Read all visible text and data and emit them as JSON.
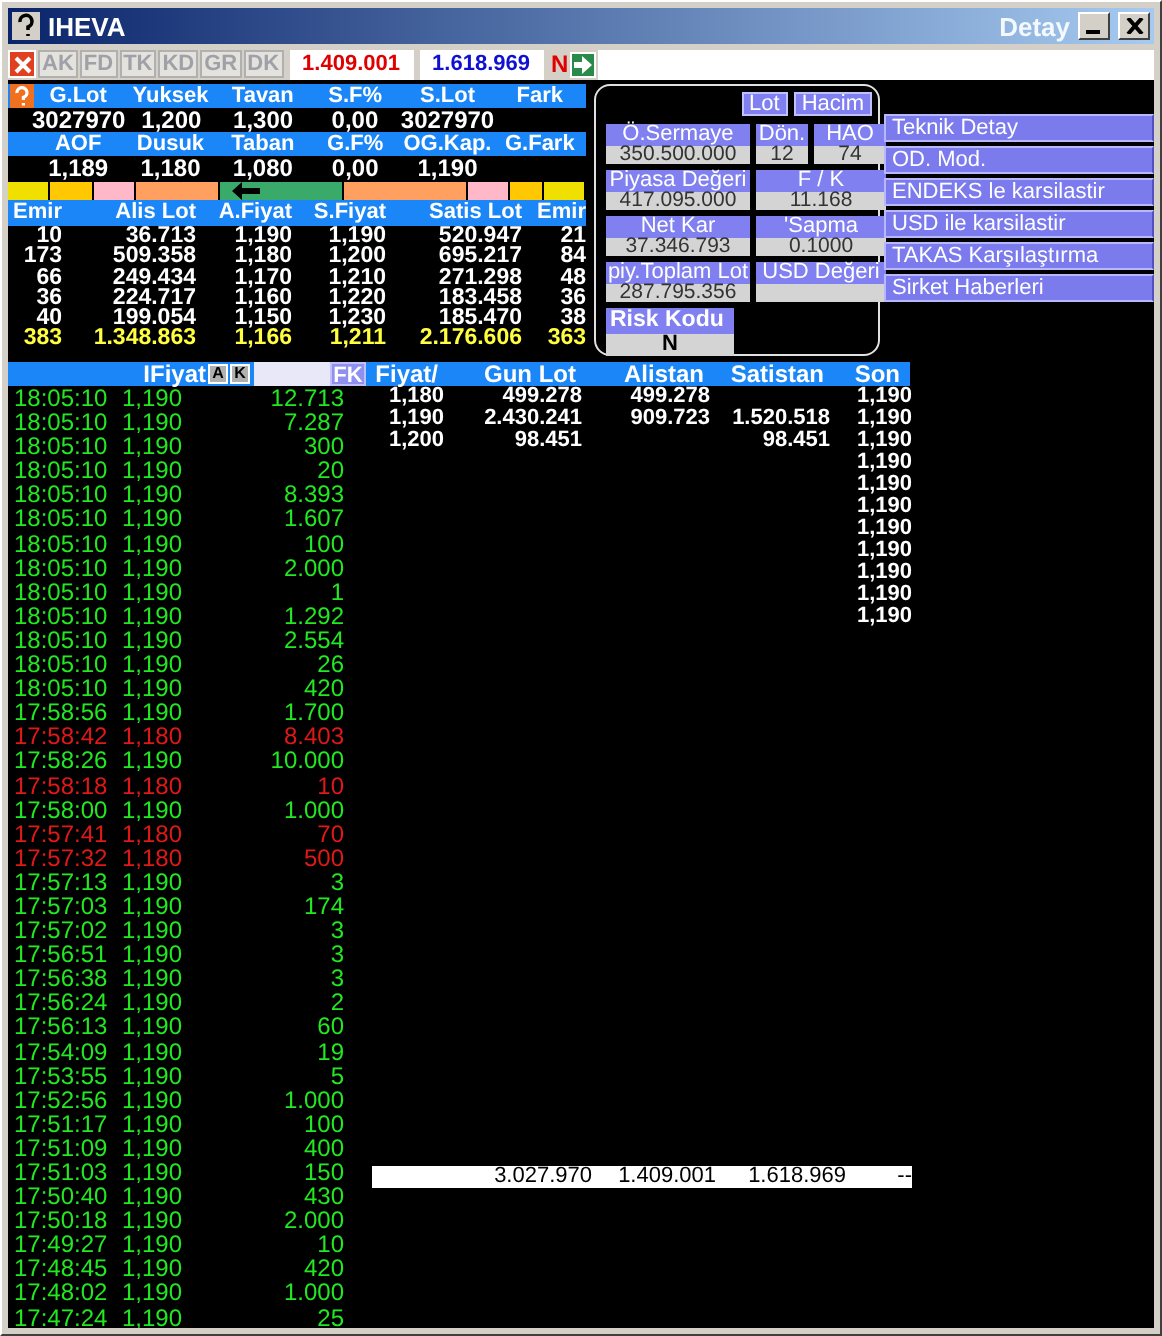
{
  "window": {
    "title": "IHEVA",
    "subtitle": "Detay"
  },
  "toolbar": {
    "tabs": [
      {
        "label": "AK",
        "disabled": true
      },
      {
        "label": "FD",
        "disabled": true
      },
      {
        "label": "TK",
        "disabled": true
      },
      {
        "label": "KD",
        "disabled": true
      },
      {
        "label": "GR",
        "disabled": true
      },
      {
        "label": "DK",
        "disabled": true
      }
    ],
    "value_red": "1.409.001",
    "value_blue": "1.618.969",
    "flag": "N"
  },
  "summary_rows": [
    {
      "kind": "header",
      "cells": [
        "G.Lot",
        "Yuksek",
        "Tavan",
        "S.F%",
        "S.Lot",
        "Fark"
      ]
    },
    {
      "kind": "values",
      "cells": [
        "3027970",
        "1,200",
        "1,300",
        "0,00",
        "3027970"
      ]
    },
    {
      "kind": "header",
      "cells": [
        "AOF",
        "Dusuk",
        "Taban",
        "G.F%",
        "OG.Kap.",
        "G.Fark"
      ]
    },
    {
      "kind": "values",
      "cells": [
        "1,189",
        "1,180",
        "1,080",
        "0,00",
        "1,190"
      ]
    }
  ],
  "depth_bar": [
    {
      "color": "#f0e000",
      "kind": "narrow"
    },
    {
      "color": "#ffc800",
      "kind": "narrow"
    },
    {
      "color": "#ffb8c8",
      "kind": "narrow"
    },
    {
      "color": "#ffa060",
      "kind": "medium"
    },
    {
      "color": "#3aaa6a",
      "kind": "wide"
    },
    {
      "color": "#ffa060",
      "kind": "wide"
    },
    {
      "color": "#ffb8c8",
      "kind": "narrow"
    },
    {
      "color": "#ffc800",
      "kind": "small"
    },
    {
      "color": "#f0e000",
      "kind": "narrow"
    }
  ],
  "order_book": {
    "columns": [
      "Emir",
      "Alis Lot",
      "A.Fiyat",
      "S.Fiyat",
      "Satis Lot",
      "Emir"
    ],
    "rows": [
      [
        "10",
        "36.713",
        "1,190",
        "1,190",
        "520.947",
        "21"
      ],
      [
        "173",
        "509.358",
        "1,180",
        "1,200",
        "695.217",
        "84"
      ],
      [
        "66",
        "249.434",
        "1,170",
        "1,210",
        "271.298",
        "48"
      ],
      [
        "36",
        "224.717",
        "1,160",
        "1,220",
        "183.458",
        "36"
      ],
      [
        "40",
        "199.054",
        "1,150",
        "1,230",
        "185.470",
        "38"
      ]
    ],
    "total": [
      "383",
      "1.348.863",
      "1,166",
      "1,211",
      "2.176.606",
      "363"
    ]
  },
  "info_panel": {
    "toggles": [
      "Lot",
      "Hacim"
    ],
    "fields": [
      {
        "kind": "wide",
        "label": "Ö.Sermaye",
        "value": "350.500.000"
      },
      {
        "kind": "narrow",
        "label": "Dön.",
        "value": "12"
      },
      {
        "kind": "narrow",
        "label": "HAO",
        "value": "74"
      },
      {
        "kind": "wide",
        "label": "Piyasa Değeri",
        "value": "417.095.000"
      },
      {
        "kind": "double",
        "label": "F / K",
        "value": "11.168"
      },
      {
        "kind": "wide",
        "label": "Net Kar",
        "value": "37.346.793"
      },
      {
        "kind": "double",
        "label": "'Sapma",
        "value": "0.1000"
      },
      {
        "kind": "wide",
        "label": "piy.Toplam Lot",
        "value": "287.795.356"
      },
      {
        "kind": "double",
        "label": "USD Değeri"
      }
    ],
    "risk": {
      "label": "Risk Kodu",
      "value": "N"
    }
  },
  "menu": [
    "Teknik Detay",
    "OD. Mod.",
    "ENDEKS le karsilastir",
    "USD ile karsilastir",
    "TAKAS Karşılaştırma",
    "Sirket Haberleri"
  ],
  "trades": {
    "header": {
      "price": "IFiyat",
      "a": "A",
      "k": "K",
      "fk": "FK"
    },
    "rows": [
      {
        "time": "18:05:10",
        "price": "1,190",
        "lot": "12.713",
        "kind": "up"
      },
      {
        "time": "18:05:10",
        "price": "1,190",
        "lot": "7.287",
        "kind": "up"
      },
      {
        "time": "18:05:10",
        "price": "1,190",
        "lot": "300",
        "kind": "up"
      },
      {
        "time": "18:05:10",
        "price": "1,190",
        "lot": "20",
        "kind": "up"
      },
      {
        "time": "18:05:10",
        "price": "1,190",
        "lot": "8.393",
        "kind": "up"
      },
      {
        "time": "18:05:10",
        "price": "1,190",
        "lot": "1.607",
        "kind": "up"
      },
      {
        "time": "18:05:10",
        "price": "1,190",
        "lot": "100",
        "kind": "up"
      },
      {
        "time": "18:05:10",
        "price": "1,190",
        "lot": "2.000",
        "kind": "up"
      },
      {
        "time": "18:05:10",
        "price": "1,190",
        "lot": "1",
        "kind": "up"
      },
      {
        "time": "18:05:10",
        "price": "1,190",
        "lot": "1.292",
        "kind": "up"
      },
      {
        "time": "18:05:10",
        "price": "1,190",
        "lot": "2.554",
        "kind": "up"
      },
      {
        "time": "18:05:10",
        "price": "1,190",
        "lot": "26",
        "kind": "up"
      },
      {
        "time": "18:05:10",
        "price": "1,190",
        "lot": "420",
        "kind": "up"
      },
      {
        "time": "17:58:56",
        "price": "1,190",
        "lot": "1.700",
        "kind": "up"
      },
      {
        "time": "17:58:42",
        "price": "1,180",
        "lot": "8.403",
        "kind": "down"
      },
      {
        "time": "17:58:26",
        "price": "1,190",
        "lot": "10.000",
        "kind": "up"
      },
      {
        "time": "17:58:18",
        "price": "1,180",
        "lot": "10",
        "kind": "down"
      },
      {
        "time": "17:58:00",
        "price": "1,190",
        "lot": "1.000",
        "kind": "up"
      },
      {
        "time": "17:57:41",
        "price": "1,180",
        "lot": "70",
        "kind": "down"
      },
      {
        "time": "17:57:32",
        "price": "1,180",
        "lot": "500",
        "kind": "down"
      },
      {
        "time": "17:57:13",
        "price": "1,190",
        "lot": "3",
        "kind": "up"
      },
      {
        "time": "17:57:03",
        "price": "1,190",
        "lot": "174",
        "kind": "up"
      },
      {
        "time": "17:57:02",
        "price": "1,190",
        "lot": "3",
        "kind": "up"
      },
      {
        "time": "17:56:51",
        "price": "1,190",
        "lot": "3",
        "kind": "up"
      },
      {
        "time": "17:56:38",
        "price": "1,190",
        "lot": "3",
        "kind": "up"
      },
      {
        "time": "17:56:24",
        "price": "1,190",
        "lot": "2",
        "kind": "up"
      },
      {
        "time": "17:56:13",
        "price": "1,190",
        "lot": "60",
        "kind": "up"
      },
      {
        "time": "17:54:09",
        "price": "1,190",
        "lot": "19",
        "kind": "up"
      },
      {
        "time": "17:53:55",
        "price": "1,190",
        "lot": "5",
        "kind": "up"
      },
      {
        "time": "17:52:56",
        "price": "1,190",
        "lot": "1.000",
        "kind": "up"
      },
      {
        "time": "17:51:17",
        "price": "1,190",
        "lot": "100",
        "kind": "up"
      },
      {
        "time": "17:51:09",
        "price": "1,190",
        "lot": "400",
        "kind": "up"
      },
      {
        "time": "17:51:03",
        "price": "1,190",
        "lot": "150",
        "kind": "up"
      },
      {
        "time": "17:50:40",
        "price": "1,190",
        "lot": "430",
        "kind": "up"
      },
      {
        "time": "17:50:18",
        "price": "1,190",
        "lot": "2.000",
        "kind": "up"
      },
      {
        "time": "17:49:27",
        "price": "1,190",
        "lot": "10",
        "kind": "up"
      },
      {
        "time": "17:48:45",
        "price": "1,190",
        "lot": "420",
        "kind": "up"
      },
      {
        "time": "17:48:02",
        "price": "1,190",
        "lot": "1.000",
        "kind": "up"
      },
      {
        "time": "17:47:24",
        "price": "1,190",
        "lot": "25",
        "kind": "up"
      }
    ]
  },
  "price_table": {
    "columns": [
      "Fiyat/",
      "Gun Lot",
      "Alistan",
      "Satistan"
    ],
    "rows": [
      [
        "1,180",
        "499.278",
        "499.278",
        ""
      ],
      [
        "1,190",
        "2.430.241",
        "909.723",
        "1.520.518"
      ],
      [
        "1,200",
        "98.451",
        "",
        "98.451"
      ]
    ]
  },
  "last": {
    "label": "Son",
    "values": [
      "1,190",
      "1,190",
      "1,190",
      "1,190",
      "1,190",
      "1,190",
      "1,190",
      "1,190",
      "1,190",
      "1,190",
      "1,190"
    ]
  },
  "totals": [
    "3.027.970",
    "1.409.001",
    "1.618.969",
    "--"
  ]
}
